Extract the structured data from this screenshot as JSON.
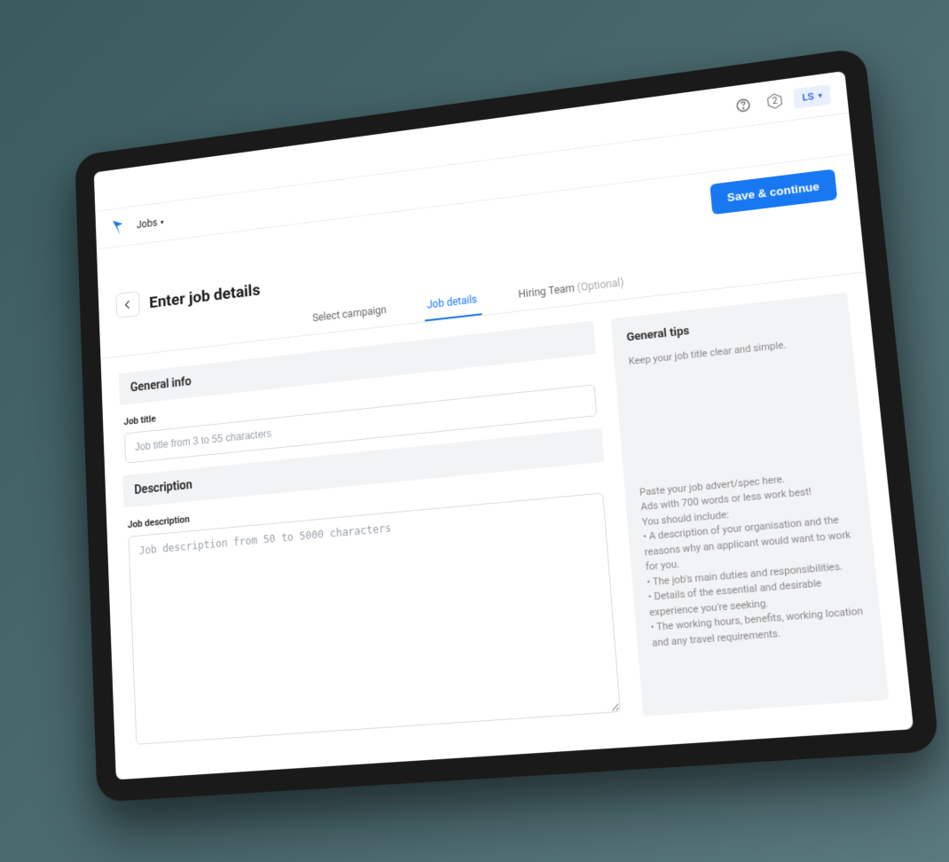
{
  "topbar": {
    "badge_count": "2",
    "user_initials": "LS"
  },
  "appbar": {
    "nav_label": "Jobs"
  },
  "actions": {
    "save_continue": "Save & continue"
  },
  "header": {
    "title": "Enter job details"
  },
  "tabs": [
    {
      "label": "Select campaign",
      "active": false,
      "optional": ""
    },
    {
      "label": "Job details",
      "active": true,
      "optional": ""
    },
    {
      "label": "Hiring Team",
      "active": false,
      "optional": "(Optional)"
    }
  ],
  "sections": {
    "general_info": {
      "heading": "General info",
      "job_title_label": "Job title",
      "job_title_placeholder": "Job title from 3 to 55 characters"
    },
    "description": {
      "heading": "Description",
      "job_desc_label": "Job description",
      "job_desc_placeholder": "Job description from 50 to 5000 characters"
    }
  },
  "tips": {
    "heading": "General tips",
    "line1": "Keep your job title clear and simple.",
    "block2": "Paste your job advert/spec here.\nAds with 700 words or less work best!\nYou should include:\n• A description of your organisation and the reasons why an applicant would want to work for you.\n• The job's main duties and responsibilities.\n• Details of the essential and desirable experience you're seeking.\n• The working hours, benefits, working location and any travel requirements."
  }
}
